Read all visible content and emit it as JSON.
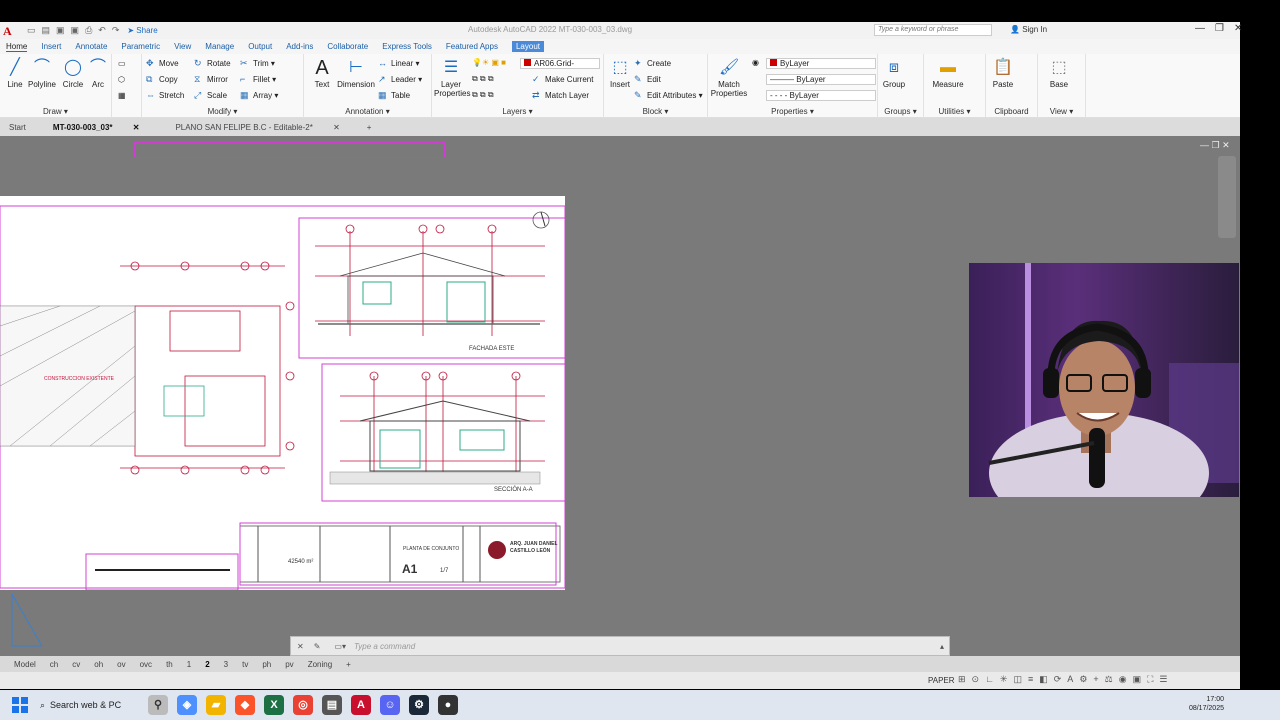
{
  "app": {
    "title": "Autodesk AutoCAD 2022   MT-030-003_03.dwg",
    "share_label": "Share",
    "search_placeholder": "Type a keyword or phrase",
    "signin_label": "Sign In"
  },
  "ribbon_tabs": [
    "Home",
    "Insert",
    "Annotate",
    "Parametric",
    "View",
    "Manage",
    "Output",
    "Add-ins",
    "Collaborate",
    "Express Tools",
    "Featured Apps",
    "Layout"
  ],
  "ribbon": {
    "draw": {
      "title": "Draw",
      "line": "Line",
      "polyline": "Polyline",
      "circle": "Circle",
      "arc": "Arc"
    },
    "modify": {
      "title": "Modify",
      "move": "Move",
      "rotate": "Rotate",
      "trim": "Trim",
      "copy": "Copy",
      "mirror": "Mirror",
      "fillet": "Fillet",
      "stretch": "Stretch",
      "scale": "Scale",
      "array": "Array"
    },
    "annotation": {
      "title": "Annotation",
      "text": "Text",
      "dimension": "Dimension",
      "linear": "Linear",
      "leader": "Leader",
      "table": "Table"
    },
    "layers": {
      "title": "Layers",
      "layer_properties": "Layer Properties",
      "current_layer": "AR06.Grid-",
      "make_current": "Make Current",
      "match_layer": "Match Layer"
    },
    "block": {
      "title": "Block",
      "insert": "Insert",
      "create": "Create",
      "edit": "Edit",
      "edit_attributes": "Edit Attributes"
    },
    "properties": {
      "title": "Properties",
      "match": "Match Properties",
      "color": "ByLayer",
      "linetype": "ByLayer",
      "lineweight": "ByLayer"
    },
    "groups": {
      "title": "Groups",
      "group": "Group"
    },
    "utilities": {
      "title": "Utilities",
      "measure": "Measure"
    },
    "clipboard": {
      "title": "Clipboard",
      "paste": "Paste"
    },
    "view": {
      "title": "View",
      "base": "Base"
    }
  },
  "doc_tabs": [
    "Start",
    "MT-030-003_03*",
    "PLANO SAN FELIPE B.C - Editable-2*"
  ],
  "drawing": {
    "label_fachada": "FACHADA ESTE",
    "label_seccion": "SECCIÓN A-A",
    "label_construccion": "CONSTRUCCION EXISTENTE",
    "title_block": {
      "sheet_name": "PLANTA DE CONJUNTO",
      "sheet_id": "A1",
      "sheet_count": "1/7",
      "area": "42540 m²",
      "architect_line1": "ARQ. JUAN DANIEL",
      "architect_line2": "CASTILLO LEÓN"
    }
  },
  "command_placeholder": "Type a command",
  "layout_tabs": [
    "Model",
    "ch",
    "cv",
    "oh",
    "ov",
    "ovc",
    "th",
    "1",
    "2",
    "3",
    "tv",
    "ph",
    "pv",
    "Zoning"
  ],
  "status": {
    "space": "PAPER"
  },
  "taskbar": {
    "search_label": "Search web & PC",
    "time": "17:00",
    "date": "08/17/2025"
  }
}
